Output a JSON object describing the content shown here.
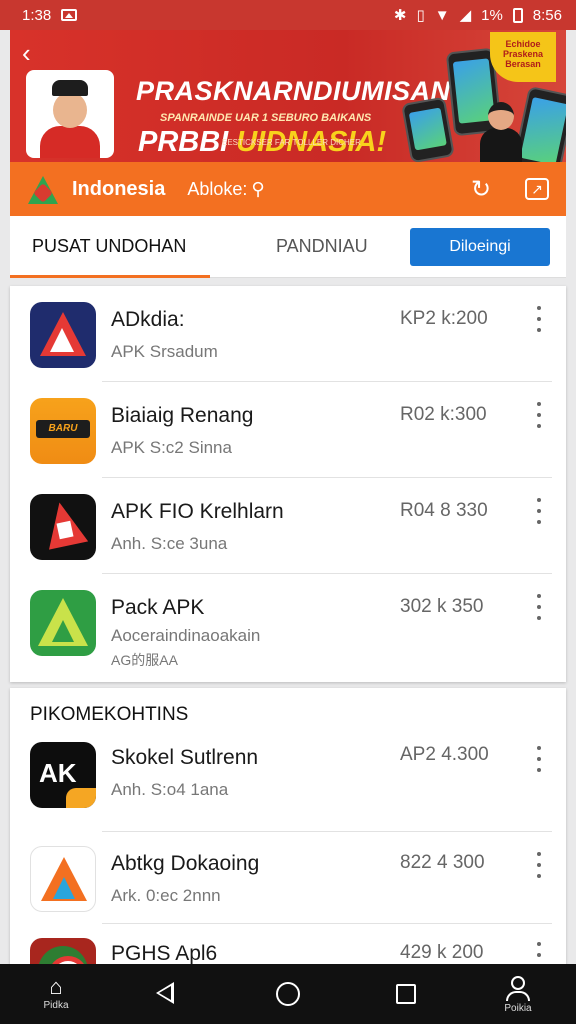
{
  "status_bar": {
    "time": "1:38",
    "right_text": "1%",
    "clock": "8:56"
  },
  "banner": {
    "headline": "PRASKNARNDIUMISAN",
    "subline": "SPANRAINDE UAR 1 SEBURO BAIKANS",
    "headline2_prefix": "PRBBI ",
    "headline2_highlight": "UIDNASIA!",
    "fine_print": "EESTICKSER FAR TOLLLER DICHER",
    "badge_text": "Echidoe Praskena Berasan"
  },
  "toolbar": {
    "region": "Indonesia",
    "search_placeholder": "Abloke:"
  },
  "tabs": {
    "tab1": "PUSAT UNDOHAN",
    "tab2": "PANDNIAU",
    "button": "Diloeingi"
  },
  "list": [
    {
      "name": "ADkdia:",
      "meta": "APK Srsadum",
      "size": "KP2 k:200"
    },
    {
      "name": "Biaiaig Renang",
      "meta": "APK S:c2 Sinna",
      "size": "R02 k:300"
    },
    {
      "name": "APK FIO Krelhlarn",
      "meta": "Anh. S:ce 3una",
      "size": "R04 8 330"
    },
    {
      "name": "Pack APK",
      "meta": "Aoceraindinaoakain",
      "meta2": "AG的服AA",
      "size": "302 k 350"
    }
  ],
  "section": {
    "title": "PIKOMEKOHTINS"
  },
  "recommended": [
    {
      "name": "Skokel Sutlrenn",
      "meta": "Anh. S:o4 1ana",
      "size": "AP2 4.300",
      "icon_text": "AK"
    },
    {
      "name": "Abtkg Dokaoing",
      "meta": "Ark. 0:ec 2nnn",
      "size": "822 4 300"
    },
    {
      "name": "PGHS Apl6",
      "meta": "",
      "size": "429 k 200"
    }
  ],
  "navbar": {
    "home_caption": "Pidka",
    "profile_caption": "Poikia"
  },
  "colors": {
    "status_red": "#c8372f",
    "toolbar_orange": "#f37021",
    "button_blue": "#1976d2"
  }
}
